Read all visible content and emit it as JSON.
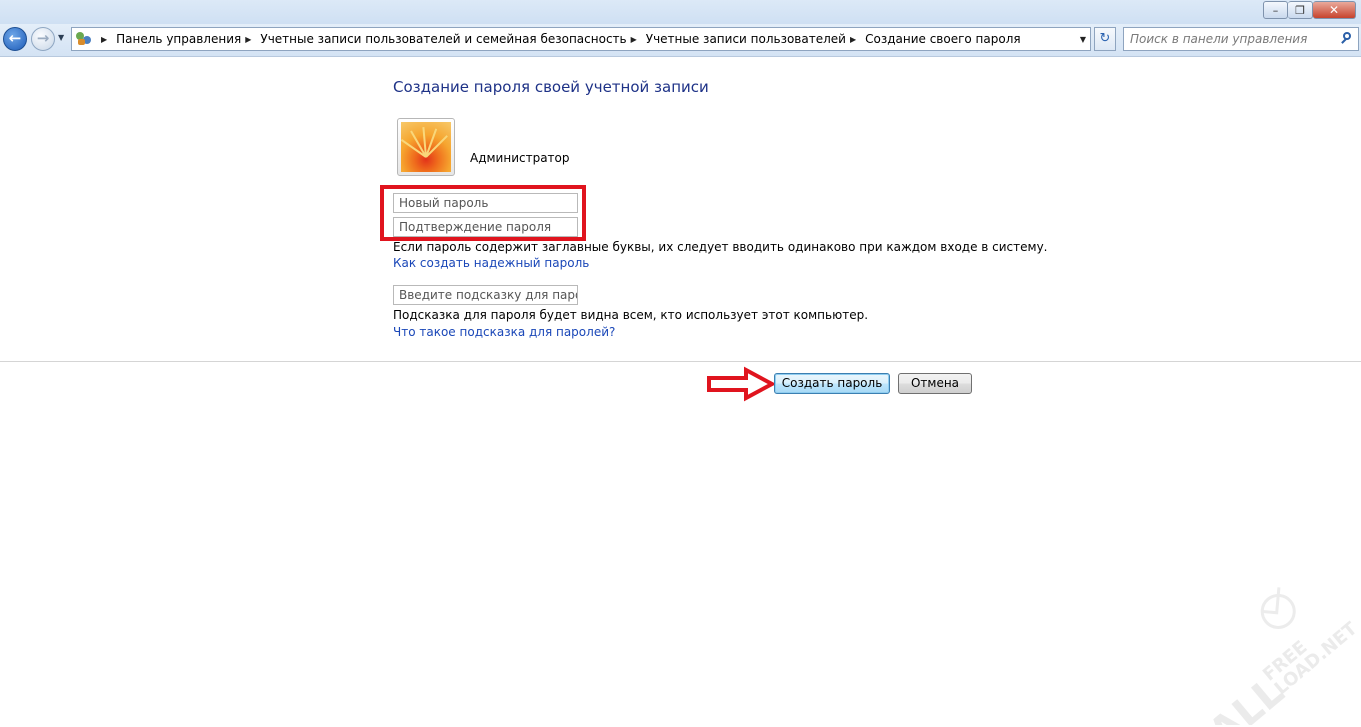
{
  "window": {
    "minimize_glyph": "–",
    "maximize_glyph": "❐",
    "close_glyph": "✕"
  },
  "nav": {
    "back_glyph": "←",
    "forward_glyph": "→",
    "breadcrumbs": [
      "Панель управления",
      "Учетные записи пользователей и семейная безопасность",
      "Учетные записи пользователей",
      "Создание своего пароля"
    ],
    "refresh_glyph": "↻",
    "search_placeholder": "Поиск в панели управления"
  },
  "page": {
    "heading": "Создание пароля своей учетной записи",
    "username": "Администратор",
    "new_password_placeholder": "Новый пароль",
    "confirm_password_placeholder": "Подтверждение пароля",
    "caps_note": "Если пароль содержит заглавные буквы, их следует вводить одинаково при каждом входе в систему.",
    "strong_password_link": "Как создать надежный пароль",
    "hint_placeholder": "Введите подсказку для пароля",
    "hint_note": "Подсказка для пароля будет видна всем, кто использует этот компьютер.",
    "hint_link": "Что такое подсказка для паролей?",
    "create_button": "Создать пароль",
    "cancel_button": "Отмена"
  },
  "annotations": {
    "highlight_color": "#e0141e"
  },
  "watermark": {
    "text": "ALL FREE LOAD.NET"
  }
}
